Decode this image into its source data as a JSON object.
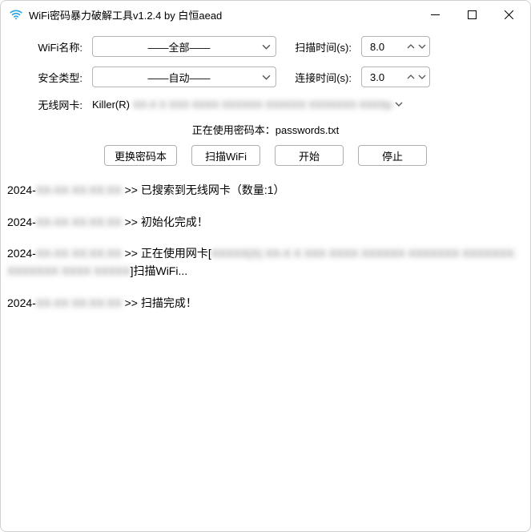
{
  "titlebar": {
    "title": "WiFi密码暴力破解工具v1.2.4 by 白恒aead"
  },
  "form": {
    "wifi_name_label": "WiFi名称:",
    "wifi_name_value": "——全部——",
    "scan_time_label": "扫描时间(s):",
    "scan_time_value": "8.0",
    "security_label": "安全类型:",
    "security_value": "——自动——",
    "connect_time_label": "连接时间(s):",
    "connect_time_value": "3.0",
    "adapter_label": "无线网卡:",
    "adapter_prefix": "Killer(R)",
    "adapter_blurred": "XX-X X XXX XXXX XXXXXX  XXXXXX  XXXXXXX  XXXXp",
    "password_line_prefix": "正在使用密码本：",
    "password_file": "passwords.txt"
  },
  "buttons": {
    "change_pw": "更换密码本",
    "scan": "扫描WiFi",
    "start": "开始",
    "stop": "停止"
  },
  "log": [
    {
      "prefix": "2024-",
      "ts_blur": "XX-XX XX:XX:XX",
      "sep": " >> ",
      "msg": "已搜索到无线网卡（数量:1）",
      "msg_blur": ""
    },
    {
      "prefix": "2024-",
      "ts_blur": "XX-XX XX:XX:XX",
      "sep": " >> ",
      "msg": "初始化完成！",
      "msg_blur": ""
    },
    {
      "prefix": "2024-",
      "ts_blur": "XX-XX XX:XX:XX",
      "sep": " >> ",
      "msg": "正在使用网卡[",
      "msg_blur": "XXXXX(X) XX-X X XXX XXXX XXXXXX XXXXXXX XXXXXXX: XXXXXXX XXXX XXXXX",
      "msg_tail": "]扫描WiFi..."
    },
    {
      "prefix": "2024-",
      "ts_blur": "XX-XX XX:XX:XX",
      "sep": " >> ",
      "msg": "扫描完成！",
      "msg_blur": ""
    }
  ]
}
